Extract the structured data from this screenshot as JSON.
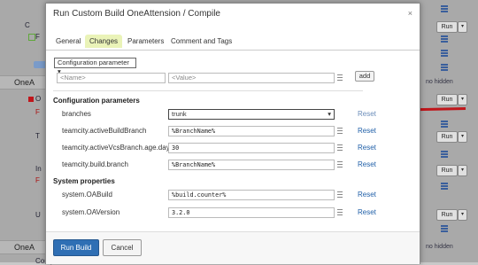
{
  "dialog": {
    "title": "Run Custom Build OneAttension / Compile",
    "close_glyph": "×",
    "tabs": [
      "General",
      "Changes",
      "Parameters",
      "Comment and Tags"
    ],
    "active_tab": "Changes",
    "add_param": {
      "type_select": "Configuration parameter",
      "name_placeholder": "<Name>",
      "value_placeholder": "<Value>",
      "add_label": "add"
    },
    "config_section_title": "Configuration parameters",
    "config_params": [
      {
        "name": "branches",
        "value": "trunk",
        "kind": "select"
      },
      {
        "name": "teamcity.activeBuildBranch",
        "value": "%BranchName%",
        "kind": "text"
      },
      {
        "name": "teamcity.activeVcsBranch.age.days",
        "value": "30",
        "kind": "text"
      },
      {
        "name": "teamcity.build.branch",
        "value": "%BranchName%",
        "kind": "text"
      }
    ],
    "system_section_title": "System properties",
    "system_params": [
      {
        "name": "system.OABuild",
        "value": "%build.counter%"
      },
      {
        "name": "system.OAVersion",
        "value": "3.2.0"
      }
    ],
    "reset_label": "Reset",
    "run_build_label": "Run Build",
    "cancel_label": "Cancel"
  },
  "background": {
    "groups": [
      "OneA",
      "OneA"
    ],
    "run_label": "Run",
    "no_hidden_label": "no hidden",
    "row_fragments": [
      "C",
      "F",
      "O",
      "F",
      "T",
      "In",
      "F",
      "U",
      "Compile"
    ],
    "status_colors": {
      "ok": "#5fa83a",
      "fail": "#c0161b",
      "warn": "#e0a020"
    }
  },
  "colors": {
    "accent": "#2f6fb4",
    "arrow": "#c0161b",
    "active_tab": "#eaf3b8",
    "link": "#1f5fa8"
  }
}
